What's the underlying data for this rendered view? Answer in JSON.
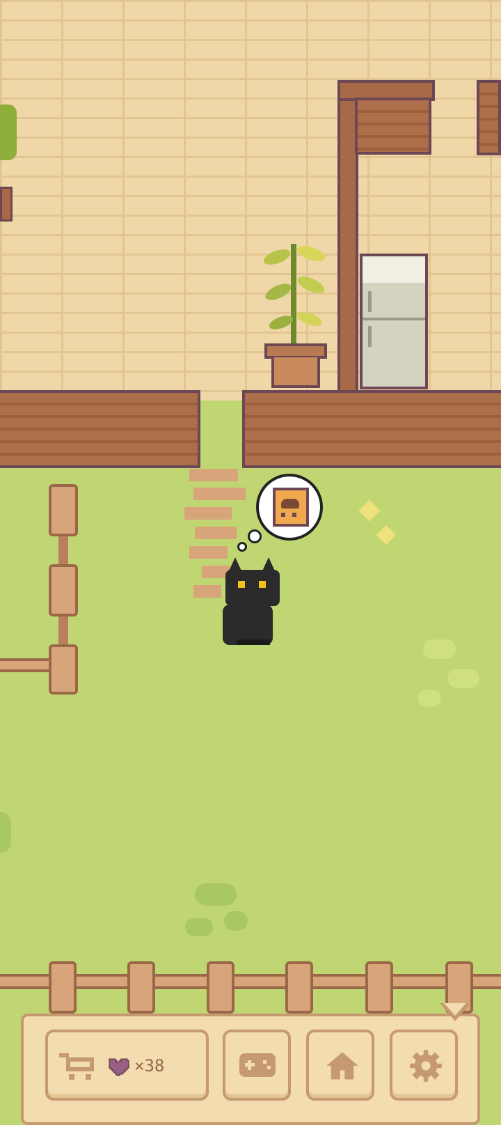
{
  "hud": {
    "shop_icon": "cart-icon",
    "currency_icon": "heart-icon",
    "currency_text": "×38",
    "games_icon": "gamepad-icon",
    "home_icon": "house-icon",
    "settings_icon": "gear-icon"
  },
  "thought_bubble": {
    "icon": "food-bag-icon"
  },
  "colors": {
    "grass": "#c0d672",
    "brick": "#f0d7a8",
    "wood": "#a86a46",
    "outline": "#6d4754",
    "hud_bg": "#f2dcb0",
    "hud_border": "#c69a70",
    "heart": "#9b5f87"
  }
}
